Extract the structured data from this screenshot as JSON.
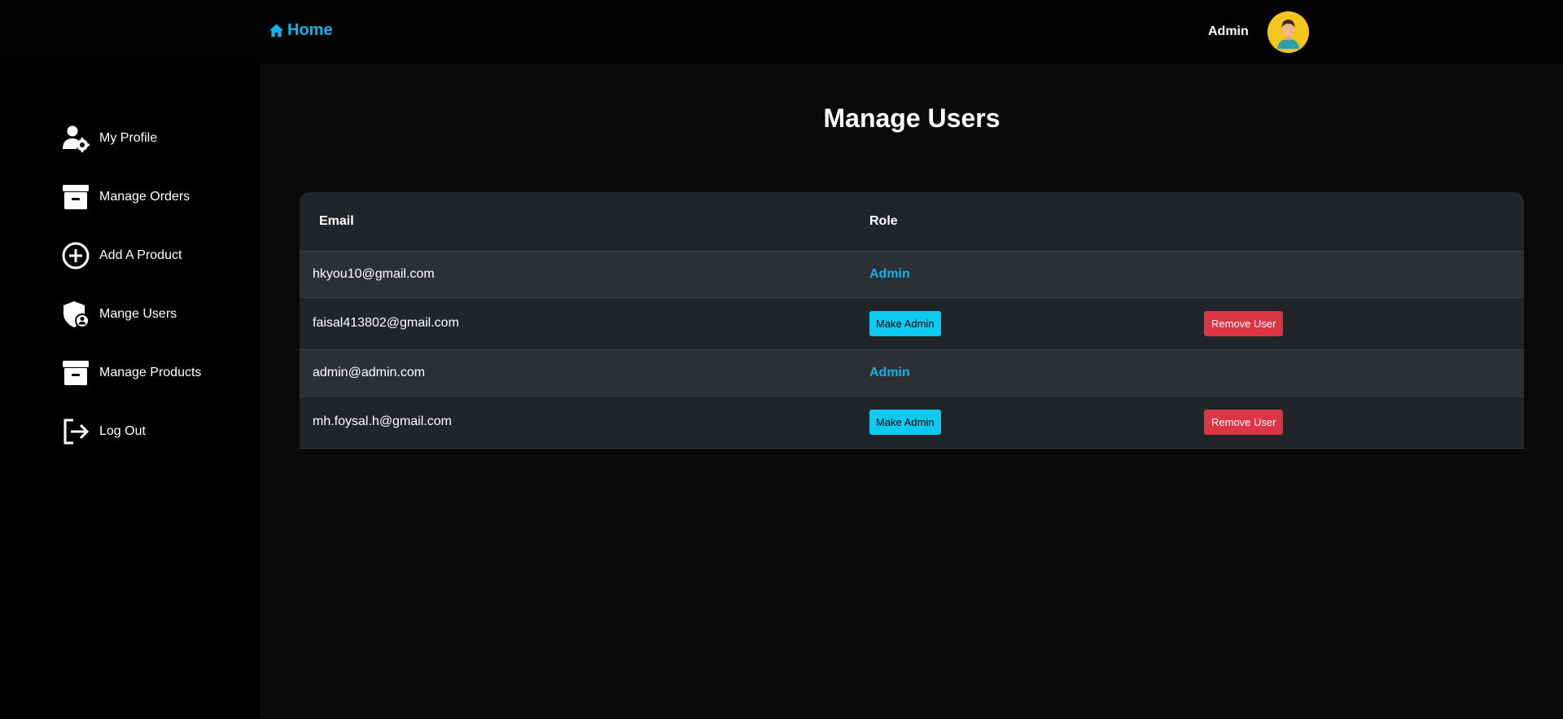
{
  "header": {
    "home_label": "Home",
    "home_icon": "home-icon",
    "user_name": "Admin",
    "avatar_icon": "user-avatar-icon"
  },
  "sidebar": {
    "items": [
      {
        "label": "My Profile",
        "icon": "user-gear-icon"
      },
      {
        "label": "Manage Orders",
        "icon": "archive-box-icon"
      },
      {
        "label": "Add A Product",
        "icon": "plus-circle-icon"
      },
      {
        "label": "Mange Users",
        "icon": "shield-user-icon"
      },
      {
        "label": "Manage Products",
        "icon": "archive-box-icon"
      },
      {
        "label": "Log Out",
        "icon": "logout-icon"
      }
    ]
  },
  "main": {
    "title": "Manage Users",
    "table": {
      "columns": [
        "Email",
        "Role",
        ""
      ],
      "rows": [
        {
          "email": "hkyou10@gmail.com",
          "role": "Admin"
        },
        {
          "email": "faisal413802@gmail.com",
          "make_admin": "Make Admin",
          "remove": "Remove User"
        },
        {
          "email": "admin@admin.com",
          "role": "Admin"
        },
        {
          "email": "mh.foysal.h@gmail.com",
          "make_admin": "Make Admin",
          "remove": "Remove User"
        }
      ]
    }
  },
  "colors": {
    "accent": "#12b3e8",
    "make_admin_button": "#0dcaf0",
    "remove_button": "#dc3545",
    "avatar_bg": "#f3c61b"
  }
}
